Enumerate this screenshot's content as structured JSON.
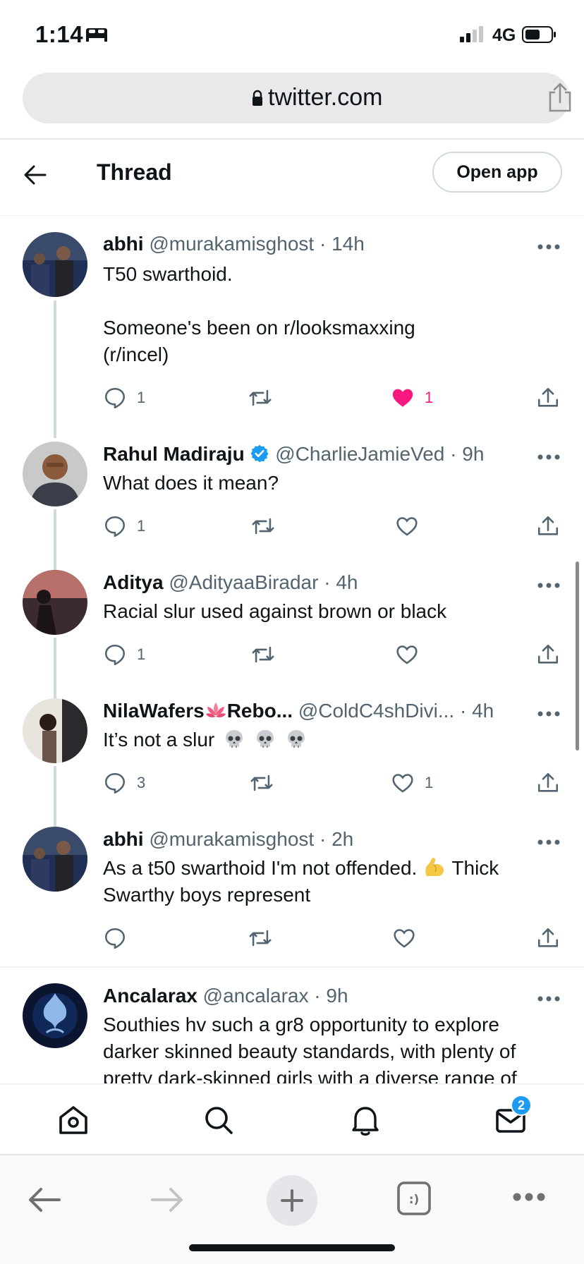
{
  "status_bar": {
    "time": "1:14",
    "network": "4G"
  },
  "browser": {
    "url": "twitter.com"
  },
  "header": {
    "title": "Thread",
    "open_app_label": "Open app"
  },
  "colors": {
    "like_pink": "#f91880",
    "verified_blue": "#1d9bf0",
    "muted_gray": "#536471"
  },
  "tweets": [
    {
      "name": "abhi",
      "handle": "@murakamisghost",
      "time": "· 14h",
      "text_line1": "T50 swarthoid.",
      "text_line2": "Someone's been on r/looksmaxxing",
      "text_line3": "(r/incel)",
      "replies": "1",
      "retweets": "",
      "likes": "1",
      "liked": true
    },
    {
      "name": "Rahul Madiraju",
      "handle": "@CharlieJamieVed",
      "time": "· 9h",
      "verified": true,
      "text": "What does it mean?",
      "replies": "1",
      "retweets": "",
      "likes": ""
    },
    {
      "name": "Aditya",
      "handle": "@AdityaaBiradar",
      "time": "· 4h",
      "text": "Racial slur used against brown or black",
      "replies": "1",
      "retweets": "",
      "likes": ""
    },
    {
      "name_part1": "NilaWafers",
      "name_part2": "Rebo...",
      "handle": "@ColdC4shDivi...",
      "time": "· 4h",
      "text": "It’s not a slur",
      "replies": "3",
      "retweets": "",
      "likes": "1"
    },
    {
      "name": "abhi",
      "handle": "@murakamisghost",
      "time": "· 2h",
      "text_a": "As a t50 swarthoid I'm not offended.",
      "text_b": "Thick",
      "text_c": "Swarthy boys represent",
      "replies": "",
      "retweets": "",
      "likes": ""
    },
    {
      "name": "Ancalarax",
      "handle": "@ancalarax",
      "time": "· 9h",
      "text_line1": "Southies hv such a gr8 opportunity to explore",
      "text_line2": "darker skinned beauty standards, with plenty of",
      "text_line3": "pretty dark-skinned girls with a diverse range of"
    }
  ],
  "tab_bar": {
    "messages_badge": "2",
    "icons": [
      "home-icon",
      "search-icon",
      "bell-icon",
      "mail-icon"
    ]
  },
  "browser_toolbar": {
    "icons": [
      "back-arrow-icon",
      "forward-arrow-icon",
      "plus-icon",
      "tabs-icon",
      "more-icon"
    ]
  }
}
